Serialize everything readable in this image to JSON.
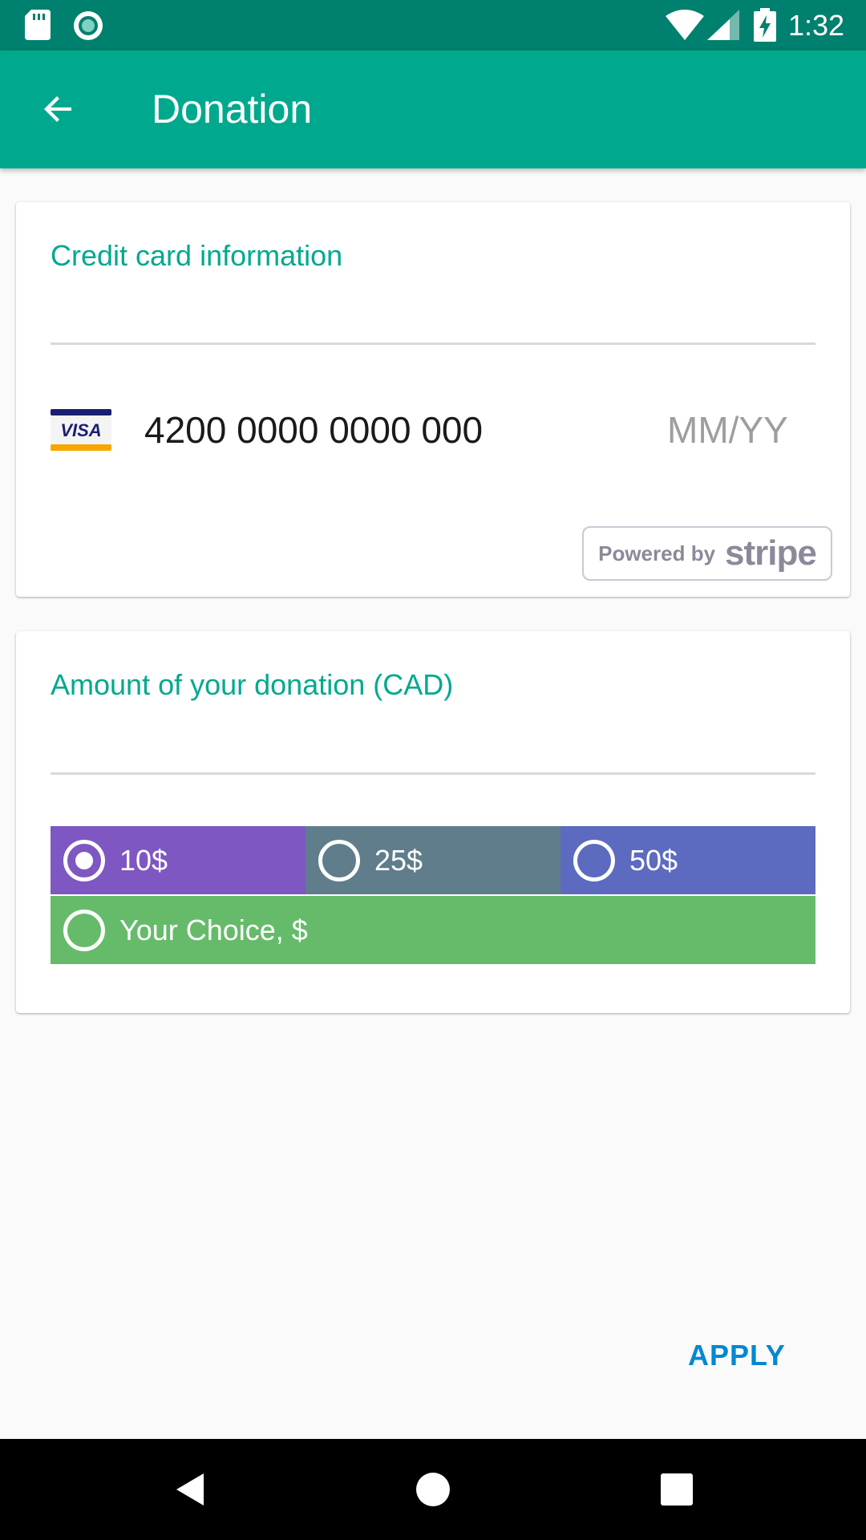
{
  "status_bar": {
    "time": "1:32",
    "icons": [
      "sd-card-icon",
      "sync-icon",
      "wifi-icon",
      "signal-icon",
      "battery-charging-icon"
    ]
  },
  "app_bar": {
    "title": "Donation",
    "back_icon": "arrow-back-icon"
  },
  "credit_card": {
    "section_label": "Credit card information",
    "brand": "VISA",
    "number": "4200 0000 0000 000",
    "expiry_placeholder": "MM/YY",
    "powered_by": "Powered by",
    "provider": "stripe"
  },
  "donation": {
    "section_label": "Amount of your donation (CAD)",
    "options": [
      {
        "label": "10$",
        "selected": true,
        "color": "#7e57c2"
      },
      {
        "label": "25$",
        "selected": false,
        "color": "#607d8b"
      },
      {
        "label": "50$",
        "selected": false,
        "color": "#5c6bc0"
      },
      {
        "label": "Your Choice, $",
        "selected": false,
        "color": "#66bb6a"
      }
    ]
  },
  "actions": {
    "apply_label": "APPLY"
  },
  "colors": {
    "status_bar": "#00806e",
    "primary": "#00a98d",
    "accent": "#0288d1"
  }
}
